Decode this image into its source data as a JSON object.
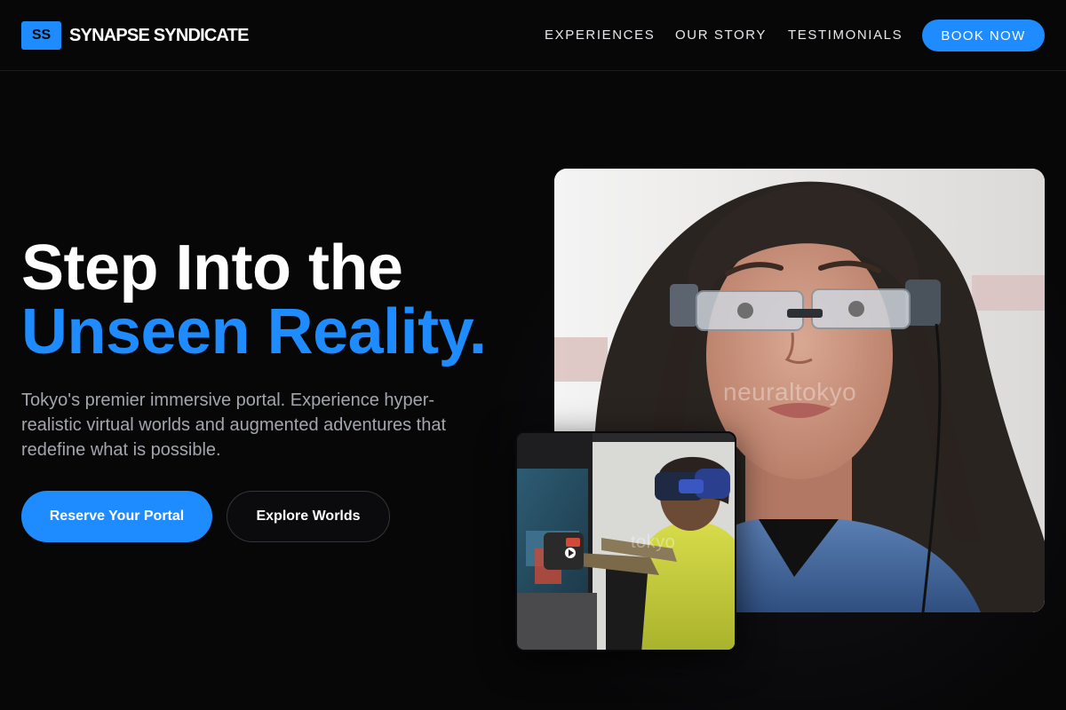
{
  "brand": {
    "badge": "SS",
    "name": "SYNAPSE SYNDICATE",
    "accent": "#1e8bff"
  },
  "nav": {
    "links": [
      "EXPERIENCES",
      "OUR STORY",
      "TESTIMONIALS"
    ],
    "cta": "BOOK NOW"
  },
  "hero": {
    "headline_line1": "Step Into the",
    "headline_line2": "Unseen Reality.",
    "subtext": "Tokyo's premier immersive portal. Experience hyper-realistic virtual worlds and augmented adventures that redefine what is possible.",
    "primary_button": "Reserve Your Portal",
    "secondary_button": "Explore Worlds"
  },
  "images": {
    "main_watermark": "neuraltokyo",
    "small_watermark": "tokyo"
  }
}
